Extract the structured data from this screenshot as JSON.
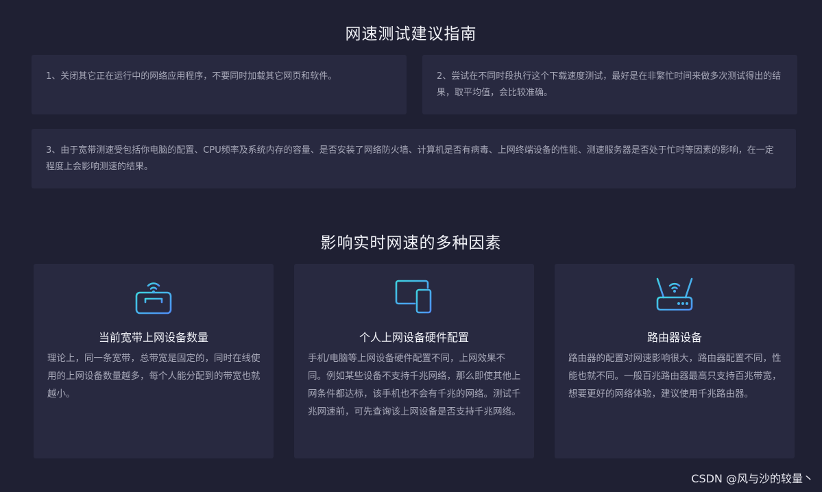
{
  "guide": {
    "title": "网速测试建议指南",
    "tips": [
      "1、关闭其它正在运行中的网络应用程序，不要同时加载其它网页和软件。",
      "2、尝试在不同时段执行这个下载速度测试，最好是在非繁忙时间来做多次测试得出的结果，取平均值，会比较准确。",
      "3、由于宽带测速受包括你电脑的配置、CPU频率及系统内存的容量、是否安装了网络防火墙、计算机是否有病毒、上网终端设备的性能、测速服务器是否处于忙时等因素的影响，在一定程度上会影响测速的结果。"
    ]
  },
  "factors": {
    "title": "影响实时网速的多种因素",
    "cards": [
      {
        "icon": "wifi-box-icon",
        "title": "当前宽带上网设备数量",
        "desc": "理论上，同一条宽带，总带宽是固定的，同时在线使用的上网设备数量越多，每个人能分配到的带宽也就越小。"
      },
      {
        "icon": "devices-icon",
        "title": "个人上网设备硬件配置",
        "desc": "手机/电脑等上网设备硬件配置不同，上网效果不同。例如某些设备不支持千兆网络，那么即使其他上网条件都达标，该手机也不会有千兆的网络。测试千兆网速前，可先查询该上网设备是否支持千兆网络。"
      },
      {
        "icon": "router-icon",
        "title": "路由器设备",
        "desc": "路由器的配置对网速影响很大，路由器配置不同，性能也就不同。一般百兆路由器最高只支持百兆带宽，想要更好的网络体验，建议使用千兆路由器。"
      }
    ]
  },
  "watermark": "CSDN @风与沙的较量丶",
  "colors": {
    "background": "#1f2033",
    "panel": "#282940",
    "icon_gradient_start": "#3fd2e0",
    "icon_gradient_end": "#4f8df5"
  }
}
